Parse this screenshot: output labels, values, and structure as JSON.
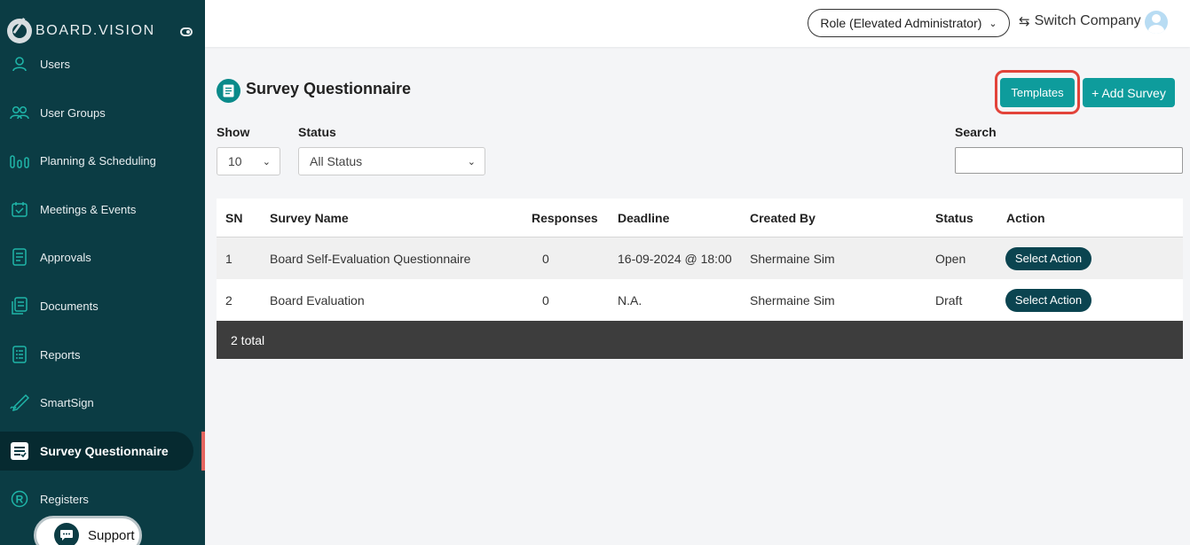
{
  "app": {
    "logo_text": "BOARD.VISION"
  },
  "header": {
    "role_label": "Role (Elevated Administrator)",
    "switch_company_label": "Switch Company"
  },
  "sidebar": {
    "items": [
      {
        "label": "Users",
        "icon": "user-icon"
      },
      {
        "label": "User Groups",
        "icon": "user-group-icon"
      },
      {
        "label": "Planning & Scheduling",
        "icon": "bar-chart-icon"
      },
      {
        "label": "Meetings & Events",
        "icon": "calendar-check-icon"
      },
      {
        "label": "Approvals",
        "icon": "document-check-icon"
      },
      {
        "label": "Documents",
        "icon": "documents-icon"
      },
      {
        "label": "Reports",
        "icon": "report-list-icon"
      },
      {
        "label": "SmartSign",
        "icon": "signature-pen-icon"
      },
      {
        "label": "Survey Questionnaire",
        "icon": "survey-icon",
        "active": true
      },
      {
        "label": "Registers",
        "icon": "registered-icon"
      }
    ],
    "support_label": "Support"
  },
  "page": {
    "title": "Survey Questionnaire",
    "templates_label": "Templates",
    "add_survey_label": "+ Add Survey",
    "show_label": "Show",
    "show_value": "10",
    "status_label": "Status",
    "status_value": "All Status",
    "search_label": "Search",
    "search_value": ""
  },
  "table": {
    "headers": {
      "sn": "SN",
      "name": "Survey Name",
      "responses": "Responses",
      "deadline": "Deadline",
      "created_by": "Created By",
      "status": "Status",
      "action": "Action"
    },
    "rows": [
      {
        "sn": "1",
        "name": "Board Self-Evaluation Questionnaire",
        "responses": "0",
        "deadline": "16-09-2024 @ 18:00",
        "created_by": "Shermaine Sim",
        "status": "Open",
        "action": "Select Action"
      },
      {
        "sn": "2",
        "name": "Board Evaluation",
        "responses": "0",
        "deadline": "N.A.",
        "created_by": "Shermaine Sim",
        "status": "Draft",
        "action": "Select Action"
      }
    ],
    "footer": "2 total"
  },
  "colors": {
    "sidebar_bg": "#0b3c44",
    "accent_teal": "#0e9c9c",
    "highlight_red": "#e2433a",
    "action_button": "#0b4450"
  }
}
